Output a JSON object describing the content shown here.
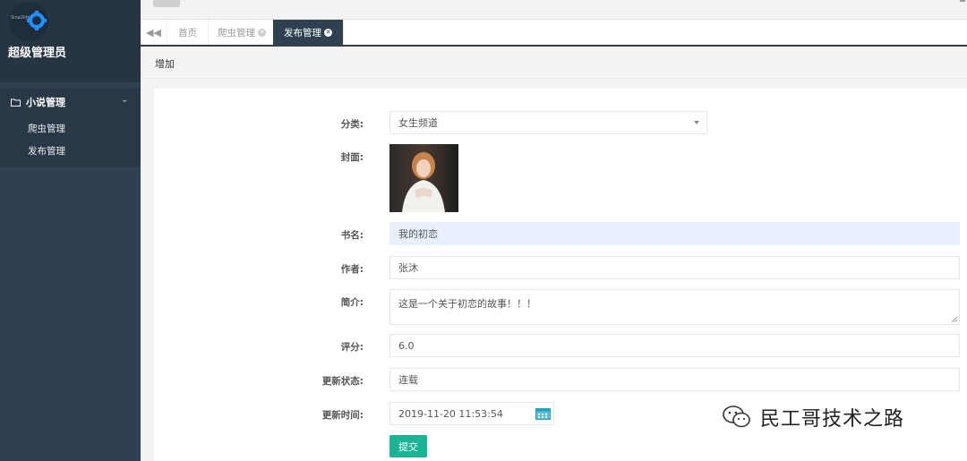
{
  "sidebar": {
    "logo_text": "Sina2life",
    "admin_name": "超级管理员",
    "section_label": "小说管理",
    "items": [
      {
        "label": "爬虫管理"
      },
      {
        "label": "发布管理"
      }
    ]
  },
  "tabs": [
    {
      "label": "首页"
    },
    {
      "label": "爬虫管理"
    },
    {
      "label": "发布管理",
      "active": true
    }
  ],
  "breadcrumb": {
    "title": "增加"
  },
  "form": {
    "category": {
      "label": "分类:",
      "value": "女生频道"
    },
    "cover": {
      "label": "封面:"
    },
    "book_name": {
      "label": "书名:",
      "value": "我的初恋"
    },
    "author": {
      "label": "作者:",
      "value": "张沐"
    },
    "intro": {
      "label": "简介:",
      "value": "这是一个关于初恋的故事！！！"
    },
    "rating": {
      "label": "评分:",
      "value": "6.0"
    },
    "update_status": {
      "label": "更新状态:",
      "value": "连载"
    },
    "update_time": {
      "label": "更新时间:",
      "value": "2019-11-20 11:53:54"
    },
    "submit_label": "提交"
  },
  "watermark": {
    "text": "民工哥技术之路"
  },
  "colors": {
    "sidebar": "#2f4050",
    "primary": "#1ab394",
    "highlight_field": "#e8f0fe"
  }
}
